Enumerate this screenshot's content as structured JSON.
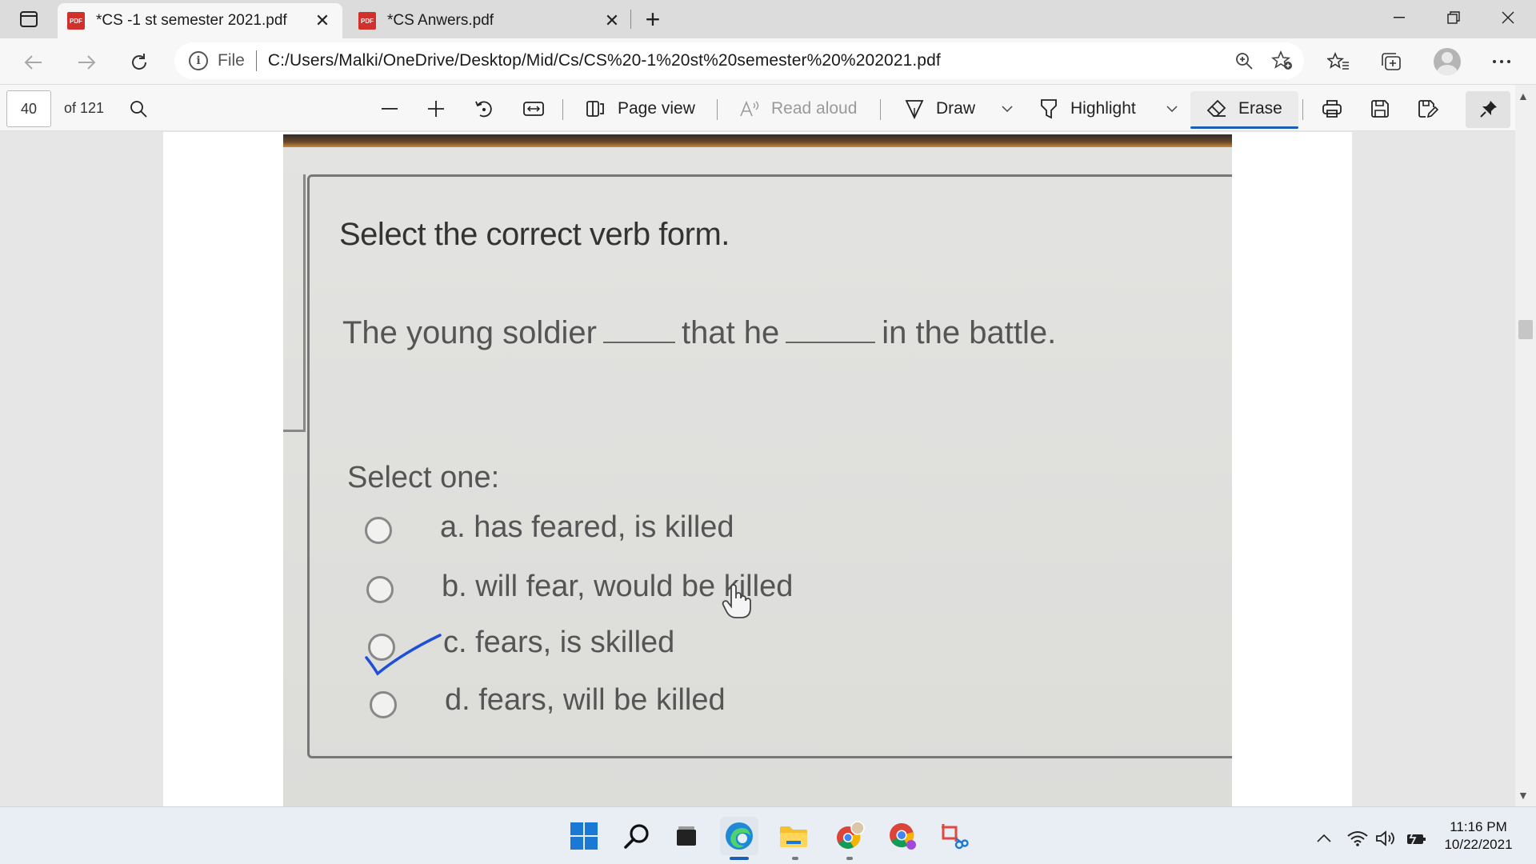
{
  "browser": {
    "tabs": [
      {
        "title": "*CS -1 st semester 2021.pdf",
        "icon": "pdf-icon",
        "active": true
      },
      {
        "title": "*CS Anwers.pdf",
        "icon": "pdf-icon",
        "active": false
      }
    ],
    "pdf_badge": "PDF",
    "close_glyph": "✕",
    "new_tab_glyph": "+",
    "address": {
      "scheme": "File",
      "url": "C:/Users/Malki/OneDrive/Desktop/Mid/Cs/CS%20-1%20st%20semester%20%202021.pdf"
    }
  },
  "pdf_toolbar": {
    "page_number": "40",
    "page_total": "of 121",
    "page_view": "Page view",
    "read_aloud": "Read aloud",
    "draw": "Draw",
    "highlight": "Highlight",
    "erase": "Erase"
  },
  "document": {
    "question_title": "Select the correct verb form.",
    "sentence_part1": "The young soldier",
    "sentence_part2": "that he",
    "sentence_part3": "in the battle.",
    "select_label": "Select one:",
    "options": [
      {
        "label": "a. has feared, is killed",
        "checked": false
      },
      {
        "label": "b. will fear, would be killed",
        "checked": false
      },
      {
        "label": "c. fears, is skilled",
        "checked": true
      },
      {
        "label": "d. fears, will be killed",
        "checked": false
      }
    ],
    "annotation_color": "#1f4fd8"
  },
  "taskbar": {
    "icons": [
      "windows-start-icon",
      "search-icon",
      "task-view-icon",
      "edge-icon",
      "file-explorer-icon",
      "chrome-profile-icon",
      "chrome-icon",
      "snipping-tool-icon"
    ],
    "clock_time": "11:16 PM",
    "clock_date": "10/22/2021"
  }
}
